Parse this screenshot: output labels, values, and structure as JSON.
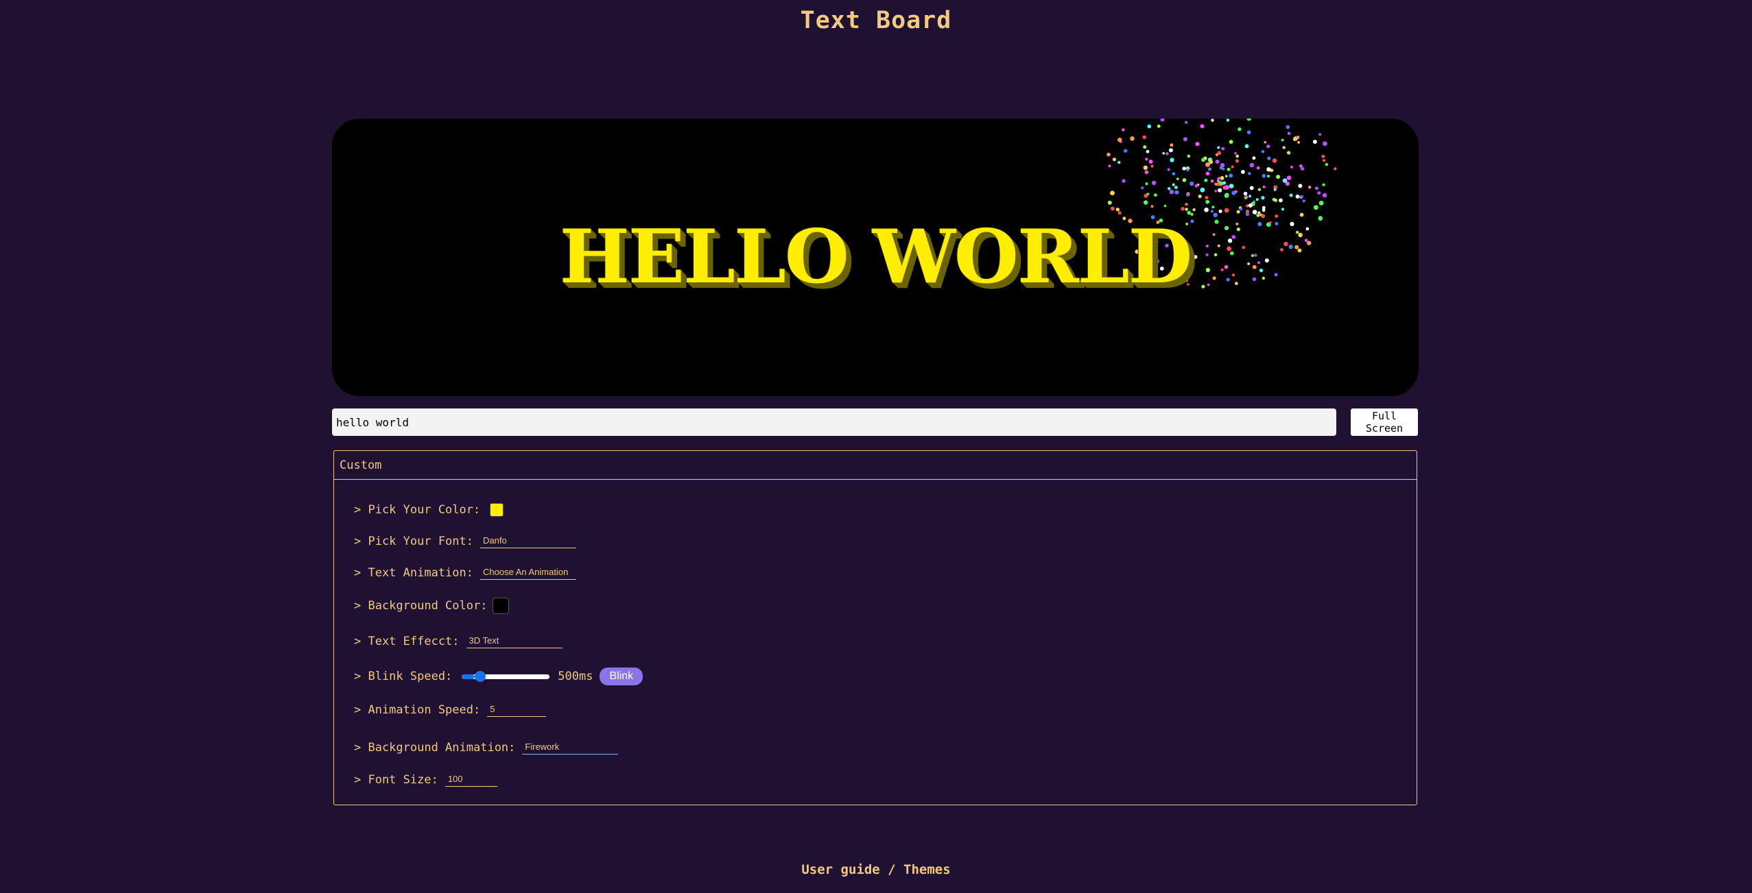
{
  "header": {
    "title": "Text Board"
  },
  "board": {
    "text": "hello world",
    "text_color": "#ffee00",
    "shadow_color": "#6b6400",
    "background_color": "#000000",
    "firework_colors": [
      "#ff4d4d",
      "#4dff4d",
      "#4d7bff",
      "#ff4dff",
      "#ffd24d",
      "#4dffff",
      "#ffffff",
      "#b84dff",
      "#ff9a4d",
      "#9aff4d"
    ]
  },
  "input": {
    "value": "hello world"
  },
  "toolbar": {
    "fullscreen_label": "Full Screen"
  },
  "panel": {
    "title": "Custom",
    "color_label": "> Pick Your Color:",
    "color_value": "#ffee00",
    "font_label": "> Pick Your Font:",
    "font_value": "Danfo",
    "animation_label": "> Text Animation:",
    "animation_value": "Choose An Animation",
    "bg_color_label": "> Background Color:",
    "bg_color_value": "#000000",
    "effect_label": "> Text Effecct:",
    "effect_value": "3D Text",
    "blink_label": "> Blink Speed:",
    "blink_fraction": 0.15,
    "blink_value": "500ms",
    "blink_button": "Blink",
    "anim_speed_label": "> Animation Speed:",
    "anim_speed_value": "5",
    "bg_anim_label": "> Background Animation:",
    "bg_anim_value": "Firework",
    "font_size_label": "> Font Size:",
    "font_size_value": "100"
  },
  "footer": {
    "user_guide": "User guide",
    "separator": " / ",
    "themes": "Themes"
  }
}
